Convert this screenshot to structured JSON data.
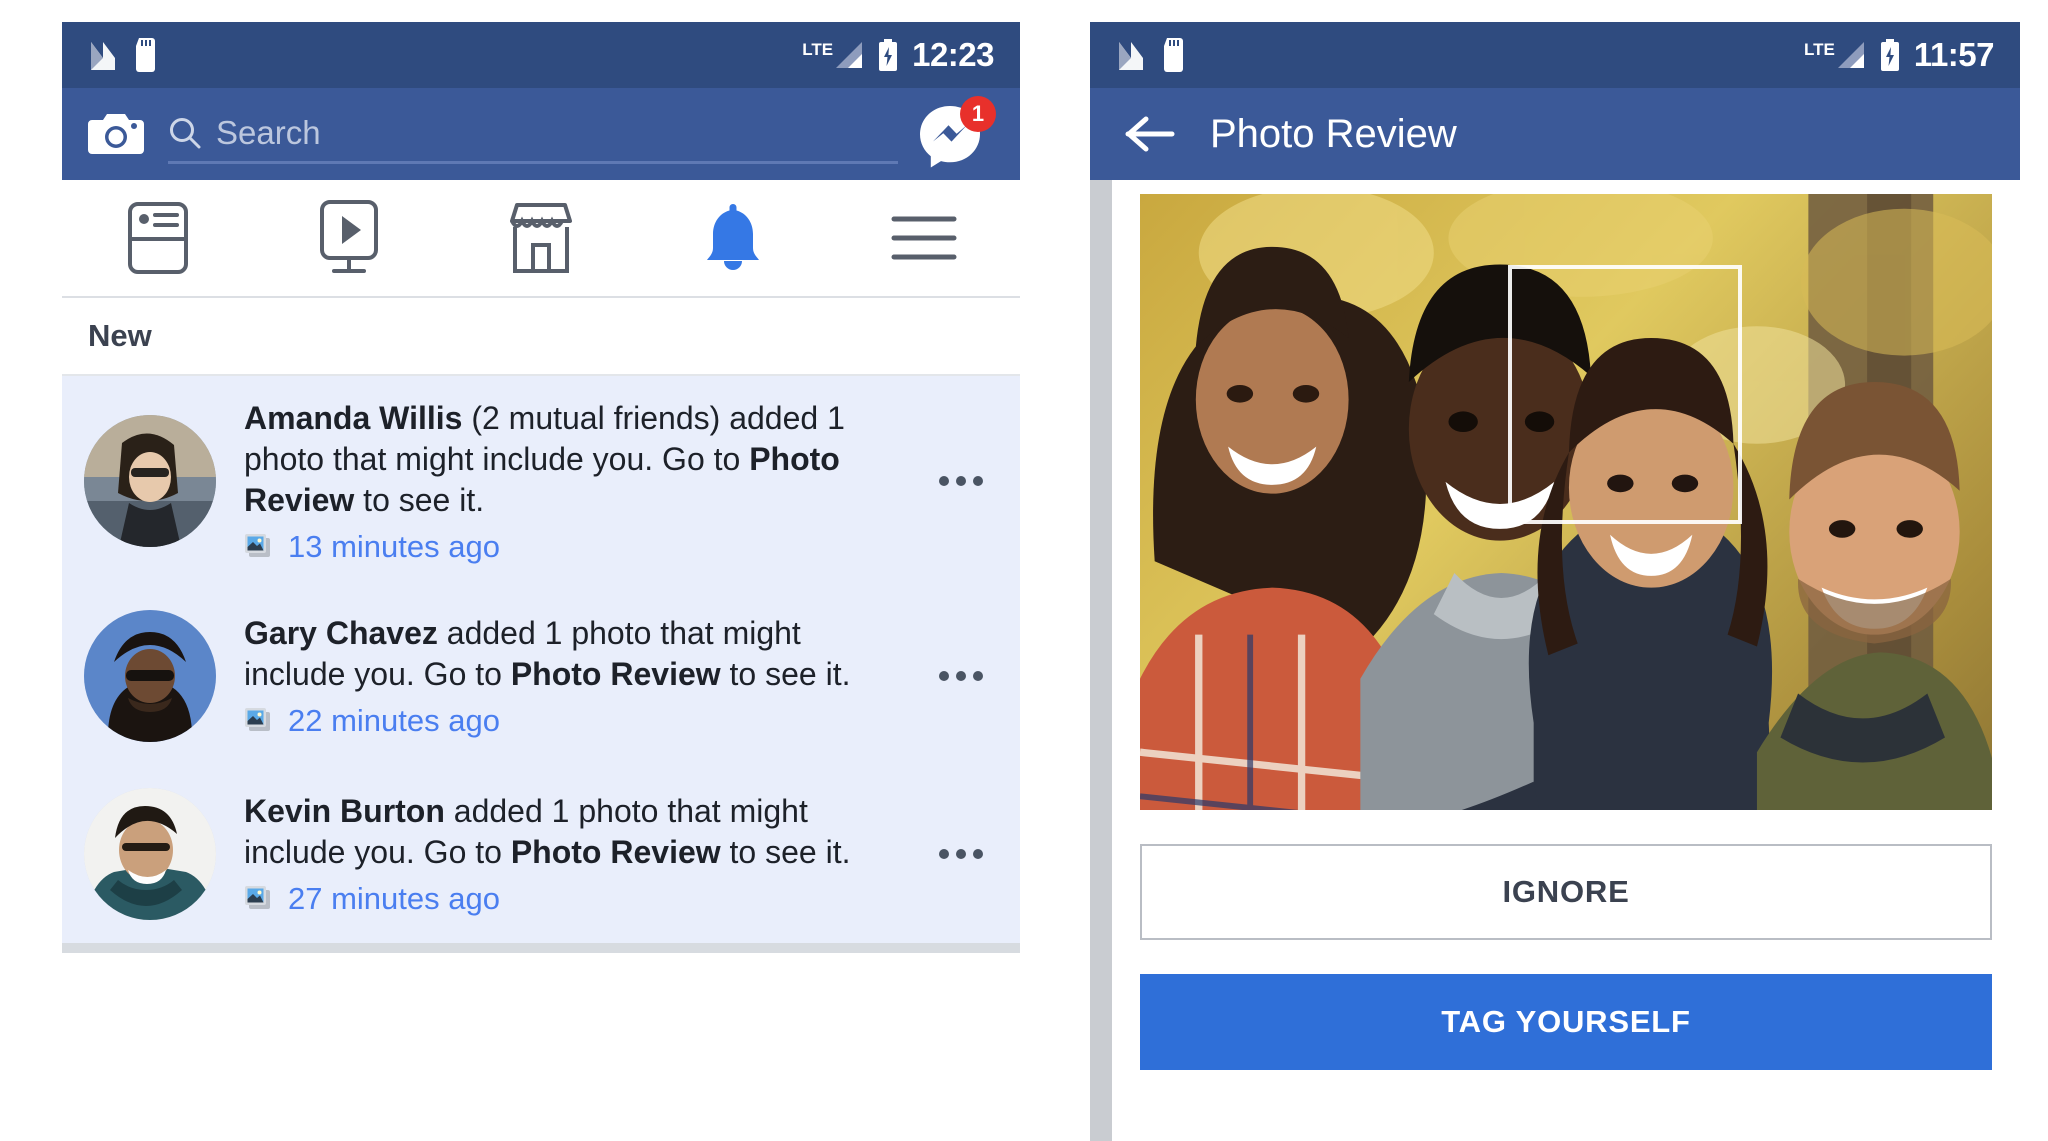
{
  "left_phone": {
    "status_bar": {
      "icons": [
        "nougat-n-icon",
        "sd-card-icon"
      ],
      "network": "LTE",
      "clock": "12:23"
    },
    "app_bar": {
      "camera_icon": "camera-icon",
      "search": {
        "placeholder": "Search",
        "value": ""
      },
      "messenger_icon": "messenger-icon",
      "messenger_badge": "1"
    },
    "tabs": [
      {
        "name": "news-feed",
        "icon": "news-feed-icon",
        "active": false
      },
      {
        "name": "watch",
        "icon": "video-watch-icon",
        "active": false
      },
      {
        "name": "marketplace",
        "icon": "marketplace-store-icon",
        "active": false
      },
      {
        "name": "notifications",
        "icon": "bell-icon",
        "active": true
      },
      {
        "name": "menu",
        "icon": "hamburger-menu-icon",
        "active": false
      }
    ],
    "section_title": "New",
    "notifications": [
      {
        "avatar": "amanda-avatar",
        "name": "Amanda Willis",
        "mutual": " (2 mutual friends)",
        "body_before": " added 1 photo that might include you. Go to ",
        "link": "Photo Review",
        "body_after": " to see it.",
        "time": "13 minutes ago",
        "time_icon": "photo-stack-icon",
        "menu_icon": "more-options-icon"
      },
      {
        "avatar": "gary-avatar",
        "name": "Gary Chavez",
        "mutual": "",
        "body_before": " added 1 photo that might include you. Go to ",
        "link": "Photo Review",
        "body_after": " to see it.",
        "time": "22 minutes ago",
        "time_icon": "photo-stack-icon",
        "menu_icon": "more-options-icon"
      },
      {
        "avatar": "kevin-avatar",
        "name": "Kevin Burton",
        "mutual": "",
        "body_before": " added 1 photo that might include you. Go to ",
        "link": "Photo Review",
        "body_after": " to see it.",
        "time": "27 minutes ago",
        "time_icon": "photo-stack-icon",
        "menu_icon": "more-options-icon"
      }
    ]
  },
  "right_phone": {
    "status_bar": {
      "icons": [
        "nougat-n-icon",
        "sd-card-icon"
      ],
      "network": "LTE",
      "clock": "11:57"
    },
    "app_bar": {
      "back_icon": "back-arrow-icon",
      "title": "Photo Review"
    },
    "photo": {
      "alt": "four-friends-autumn-photo",
      "face_box": "face-tag-selection-box"
    },
    "buttons": {
      "ignore": "IGNORE",
      "tag": "TAG YOURSELF"
    }
  },
  "colors": {
    "status_bar": "#2f4b7f",
    "app_bar": "#3b5998",
    "accent_blue": "#4a7ef0",
    "primary_button": "#2f6fd8",
    "badge_red": "#e8302b",
    "unread_row": "#e9eefb"
  }
}
